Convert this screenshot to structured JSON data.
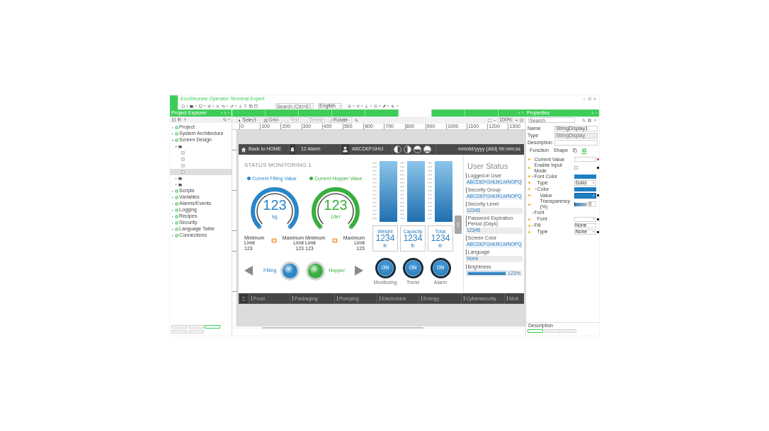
{
  "window": {
    "title": "EcoStruxure Operator Terminal Expert"
  },
  "toolbar": {
    "search": {
      "placeholder": "Search (Ctrl+E)"
    },
    "language": "English"
  },
  "left_panel": {
    "title": "Project Explorer",
    "tree": [
      {
        "label": "Project",
        "expanded": false,
        "selected": false
      },
      {
        "label": "System Architecture",
        "expanded": false,
        "selected": false
      },
      {
        "label": "Screen Design",
        "expanded": true,
        "selected": false,
        "children": [
          {
            "expanded": true,
            "selected": false,
            "children": [
              {
                "selected": false
              },
              {
                "selected": false
              },
              {
                "selected": false
              },
              {
                "selected": true
              }
            ]
          },
          {
            "expanded": false,
            "selected": false
          },
          {
            "expanded": false,
            "selected": false
          }
        ]
      },
      {
        "label": "Scripts",
        "expanded": false,
        "selected": false
      },
      {
        "label": "Variables",
        "expanded": false,
        "selected": false
      },
      {
        "label": "Alarms/Events",
        "expanded": false,
        "selected": false
      },
      {
        "label": "Logging",
        "expanded": false,
        "selected": false
      },
      {
        "label": "Recipes",
        "expanded": false,
        "selected": false
      },
      {
        "label": "Security",
        "expanded": false,
        "selected": false
      },
      {
        "label": "Language Table",
        "expanded": false,
        "selected": false
      },
      {
        "label": "Connections",
        "expanded": false,
        "selected": false
      }
    ],
    "bottom_tabs": [
      {
        "selected": false
      },
      {
        "selected": false
      },
      {
        "selected": true
      }
    ],
    "output_tabs": [
      {
        "selected": false
      },
      {
        "selected": false
      }
    ]
  },
  "doc_tabs": [
    {
      "selected": false
    },
    {
      "selected": false
    },
    {
      "selected": false
    },
    {
      "selected": false
    },
    {
      "selected": false
    },
    {
      "selected": true
    },
    {
      "selected": false
    },
    {
      "selected": false
    }
  ],
  "editor_toolbar": {
    "tools": [
      {
        "label": "Select",
        "disabled": false
      },
      {
        "label": "Grid",
        "disabled": false
      },
      {
        "label": "Text",
        "disabled": true
      },
      {
        "label": "Delete",
        "disabled": true
      },
      {
        "label": "Rotate",
        "disabled": false
      }
    ],
    "zoom": "100%"
  },
  "ruler": [
    "0",
    "100",
    "200",
    "300",
    "400",
    "500",
    "600",
    "700",
    "800",
    "900",
    "1000",
    "1100",
    "1200",
    "1300"
  ],
  "hmi": {
    "top_bar": {
      "home": "Back to HOME",
      "alarms": "12 Alarm",
      "user": "ABCDEFGHIJ",
      "datetime": "mm/dd/yyyy (ddd) hh:mm:ss"
    },
    "title": "STATUS MONITORING 1",
    "legend": [
      {
        "label": "Current Filling Value",
        "color": "#2a86c9"
      },
      {
        "label": "Current Hopper Value",
        "color": "#3aae3f"
      }
    ],
    "gauges": [
      {
        "value": "123",
        "unit": "kg",
        "color": "#2a86c9",
        "min_label": "Minimum Limit",
        "min_value": "123",
        "max_label": "Maximum Limit",
        "max_value": "123"
      },
      {
        "value": "123",
        "unit": "Liter",
        "color": "#3aae3f",
        "min_label": "Minimum Limit",
        "min_value": "123",
        "max_label": "Maximum Limit",
        "max_value": "123"
      }
    ],
    "selector": [
      {
        "label": "Filling",
        "color": "#2a86c9"
      },
      {
        "label": "Hopper",
        "color": "#3aae3f"
      }
    ],
    "tanks": [
      {
        "label": "Weight",
        "value": "1234",
        "unit": "lb",
        "toggle": "ON",
        "caption": "Monitoring",
        "on": true
      },
      {
        "label": "Capacity",
        "value": "1234",
        "unit": "lb",
        "toggle": "ON",
        "caption": "Trend",
        "on": true
      },
      {
        "label": "Total",
        "value": "1234",
        "unit": "lb",
        "toggle": "ON",
        "caption": "Alarm",
        "on": true
      }
    ],
    "user_status": {
      "title": "User Status",
      "fields": [
        {
          "label": "Logged-in User",
          "value": "ABCDEFGHIJKLMNOPQ",
          "kind": "string"
        },
        {
          "label": "Security Group",
          "value": "ABCDEFGHIJKLMNOPQ",
          "kind": "string"
        },
        {
          "label": "Security Level",
          "value": "12345",
          "kind": "box"
        },
        {
          "label": "Password Expiration Period (Days)",
          "value": "12345",
          "kind": "box"
        },
        {
          "label": "Screen Color",
          "value": "ABCDEFGHIJKLMNOPQ",
          "kind": "string"
        },
        {
          "label": "Language",
          "value": "None",
          "kind": "box"
        },
        {
          "label": "Brightness",
          "value": "123%",
          "kind": "bar",
          "level": 1
        }
      ]
    },
    "nav": [
      "Food",
      "Packaging",
      "Pumping",
      "Electronics",
      "Energy",
      "Cybersecurity",
      "Mult"
    ]
  },
  "properties": {
    "title": "Properties",
    "search": {
      "placeholder": "Search"
    },
    "fields": [
      {
        "label": "Name",
        "value": "StringDisplay1",
        "readonly": false
      },
      {
        "label": "Type",
        "value": "StringDisplay",
        "readonly": true
      },
      {
        "label": "Description"
      }
    ],
    "tabs": [
      {
        "kind": "text",
        "label": "Function",
        "selected": false
      },
      {
        "kind": "text",
        "label": "Shape",
        "selected": false
      },
      {
        "kind": "layers",
        "selected": false
      },
      {
        "kind": "style",
        "selected": true
      }
    ],
    "rows": [
      {
        "kind": "text",
        "label": "Current Value",
        "bound": true
      },
      {
        "kind": "check",
        "label": "Enable Input Mode",
        "checked": false,
        "bound": false
      },
      {
        "kind": "color",
        "label": "Font Color",
        "color": "#1f7fc4",
        "expanded": true,
        "children": [
          {
            "kind": "select",
            "label": "Type",
            "value": "Solid"
          },
          {
            "kind": "color",
            "label": "Color",
            "color": "#1f7fc4",
            "expanded": true,
            "children": [
              {
                "kind": "colorselect",
                "label": "Value",
                "color": "#1f7fc4",
                "bound": false
              },
              {
                "kind": "slider",
                "label": "Transparency (%)",
                "level": 0,
                "value": "0"
              }
            ]
          }
        ]
      },
      {
        "kind": "group",
        "label": "Font",
        "expanded": true,
        "children": [
          {
            "kind": "select",
            "label": "Font",
            "bound": false
          }
        ]
      },
      {
        "kind": "text",
        "label": "Fill",
        "value": "None",
        "expanded": true,
        "children": [
          {
            "kind": "select",
            "label": "Type",
            "value": "None",
            "bound": false
          }
        ]
      }
    ],
    "footer": "Description",
    "bottom_tabs": [
      {
        "selected": true
      },
      {
        "selected": false
      },
      {
        "selected": false
      }
    ]
  }
}
